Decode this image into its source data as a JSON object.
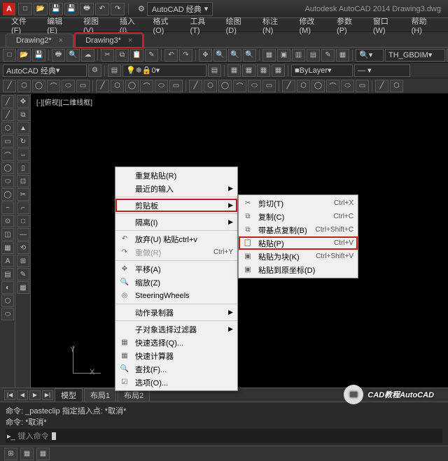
{
  "app": {
    "title_right": "Autodesk AutoCAD 2014    Drawing3.dwg",
    "logo": "A"
  },
  "workspace": {
    "label": "AutoCAD 经典"
  },
  "menus": [
    "文件(F)",
    "编辑(E)",
    "视图(V)",
    "插入(I)",
    "格式(O)",
    "工具(T)",
    "绘图(D)",
    "标注(N)",
    "修改(M)",
    "参数(P)",
    "窗口(W)",
    "帮助(H)"
  ],
  "doc_tabs": [
    {
      "label": "Drawing2*",
      "active": false,
      "hl": false
    },
    {
      "label": "Drawing3*",
      "active": true,
      "hl": true
    }
  ],
  "toolbar2": {
    "ws": "AutoCAD 经典",
    "layer": "0",
    "linetype": "ByLayer",
    "flydd": "TH_GBDIM"
  },
  "view_label": "[-][俯视][二维线框]",
  "ctx_main": [
    {
      "label": "重复粘贴(R)",
      "ico": ""
    },
    {
      "label": "最近的输入",
      "arr": true
    },
    {
      "sep": true
    },
    {
      "label": "剪贴板",
      "arr": true,
      "hl": true
    },
    {
      "sep": true
    },
    {
      "label": "隔离(I)",
      "arr": true
    },
    {
      "sep": true
    },
    {
      "label": "放弃(U) 粘贴ctrl+v",
      "ico": "↶"
    },
    {
      "label": "重做(R)",
      "ico": "↷",
      "sc": "Ctrl+Y",
      "disabled": true
    },
    {
      "sep": true
    },
    {
      "label": "平移(A)",
      "ico": "✥"
    },
    {
      "label": "缩放(Z)",
      "ico": "🔍"
    },
    {
      "label": "SteeringWheels",
      "ico": "◎"
    },
    {
      "sep": true
    },
    {
      "label": "动作录制器",
      "arr": true
    },
    {
      "sep": true
    },
    {
      "label": "子对象选择过滤器",
      "arr": true
    },
    {
      "label": "快速选择(Q)...",
      "ico": "▦"
    },
    {
      "label": "快速计算器",
      "ico": "▦"
    },
    {
      "label": "查找(F)...",
      "ico": "🔍"
    },
    {
      "label": "选项(O)...",
      "ico": "☑"
    }
  ],
  "ctx_sub": [
    {
      "label": "剪切(T)",
      "ico": "✂",
      "sc": "Ctrl+X"
    },
    {
      "label": "复制(C)",
      "ico": "⧉",
      "sc": "Ctrl+C"
    },
    {
      "label": "带基点复制(B)",
      "ico": "⧉",
      "sc": "Ctrl+Shift+C"
    },
    {
      "label": "粘贴(P)",
      "ico": "📋",
      "sc": "Ctrl+V",
      "hl": true
    },
    {
      "label": "粘贴为块(K)",
      "ico": "▣",
      "sc": "Ctrl+Shift+V"
    },
    {
      "label": "粘贴到原坐标(D)",
      "ico": "▣"
    }
  ],
  "layout_tabs": {
    "nav": [
      "|◀",
      "◀",
      "▶",
      "▶|"
    ],
    "tabs": [
      "模型",
      "布局1",
      "布局2"
    ],
    "active": 0
  },
  "cmd": {
    "line1": "命令: _pasteclip 指定插入点: *取消*",
    "line2": "命令: *取消*",
    "prompt": "键入命令"
  },
  "watermark": "CAD教程AutoCAD"
}
